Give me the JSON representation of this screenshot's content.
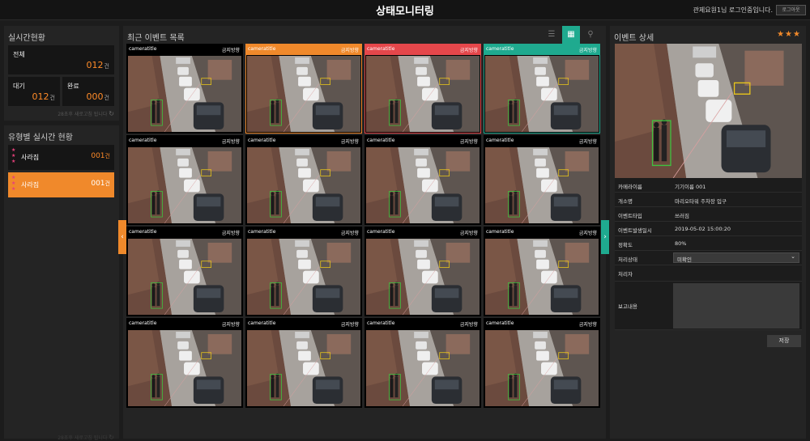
{
  "header": {
    "title": "상태모니터링",
    "login_text": "관제요원1님 로그인중입니다.",
    "logout_label": "로그아웃"
  },
  "left": {
    "realtime_title": "실시간현황",
    "total": {
      "label": "전체",
      "value": "012",
      "unit": "건"
    },
    "waiting": {
      "label": "대기",
      "value": "012",
      "unit": "건"
    },
    "done": {
      "label": "완료",
      "value": "000",
      "unit": "건"
    },
    "refresh_note": "28초후 새로고침 됩니다",
    "type_title": "유형별 실시간 현황",
    "types": [
      {
        "name": "사라짐",
        "count": "001",
        "unit": "건",
        "stars": "★★★"
      },
      {
        "name": "사라짐",
        "count": "001",
        "unit": "건",
        "stars": "★★★"
      }
    ],
    "bottom_note": "28초후 새로고침 됩니다"
  },
  "center": {
    "title": "최근 이벤트 목록",
    "view_icons": [
      "list-view-icon",
      "grid-view-icon",
      "map-pin-icon"
    ],
    "arrow_left": "‹",
    "arrow_right": "›",
    "cells": [
      {
        "camera": "cameratitle",
        "event": "금지방향",
        "state": "normal"
      },
      {
        "camera": "cameratitle",
        "event": "금지방향",
        "state": "orange"
      },
      {
        "camera": "cameratitle",
        "event": "금지방향",
        "state": "red"
      },
      {
        "camera": "cameratitle",
        "event": "금지방향",
        "state": "teal"
      },
      {
        "camera": "cameratitle",
        "event": "금지방향",
        "state": "normal"
      },
      {
        "camera": "cameratitle",
        "event": "금지방향",
        "state": "normal"
      },
      {
        "camera": "cameratitle",
        "event": "금지방향",
        "state": "normal"
      },
      {
        "camera": "cameratitle",
        "event": "금지방향",
        "state": "normal"
      },
      {
        "camera": "cameratitle",
        "event": "금지방향",
        "state": "normal"
      },
      {
        "camera": "cameratitle",
        "event": "금지방향",
        "state": "normal"
      },
      {
        "camera": "cameratitle",
        "event": "금지방향",
        "state": "normal"
      },
      {
        "camera": "cameratitle",
        "event": "금지방향",
        "state": "normal"
      },
      {
        "camera": "cameratitle",
        "event": "금지방향",
        "state": "normal"
      },
      {
        "camera": "cameratitle",
        "event": "금지방향",
        "state": "normal"
      },
      {
        "camera": "cameratitle",
        "event": "금지방향",
        "state": "normal"
      },
      {
        "camera": "cameratitle",
        "event": "금지방향",
        "state": "normal"
      }
    ]
  },
  "detail": {
    "title": "이벤트 상세",
    "stars": "★★★",
    "rows": [
      {
        "key": "카메라이름",
        "value": "기기이름 001"
      },
      {
        "key": "개소명",
        "value": "마리오타워 주차장 입구"
      },
      {
        "key": "이벤트타입",
        "value": "쓰러짐"
      },
      {
        "key": "이벤트발생일시",
        "value": "2019-05-02 15:00:20"
      },
      {
        "key": "정확도",
        "value": "80%"
      }
    ],
    "status_label": "처리상태",
    "status_value": "미확인",
    "handler_label": "처리자",
    "report_label": "보고내용",
    "save_label": "저장"
  },
  "colors": {
    "accent_orange": "#f0892b",
    "alert_red": "#e5474b",
    "accent_teal": "#1faa8f",
    "star_pink": "#e5407a"
  }
}
